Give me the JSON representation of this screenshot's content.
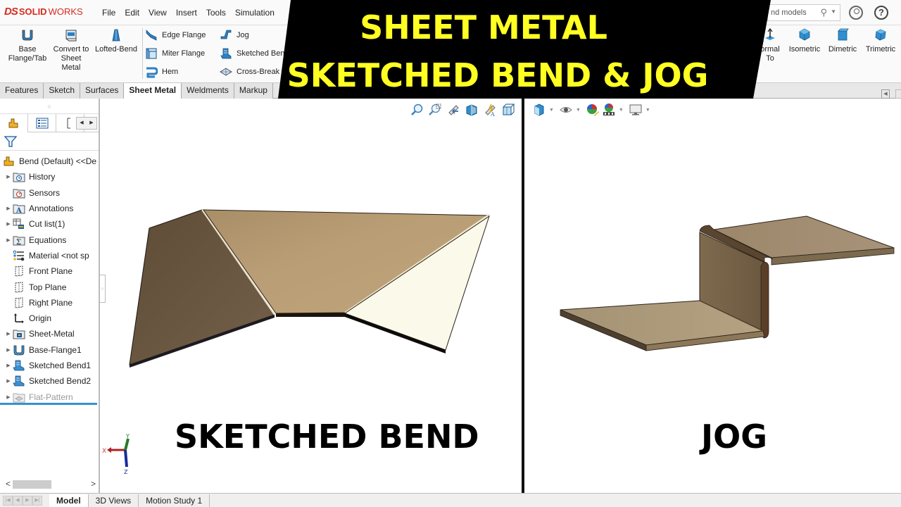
{
  "app": {
    "brand_prefix": "DS",
    "brand_bold": "SOLID",
    "brand_light": "WORKS"
  },
  "menu": [
    "File",
    "Edit",
    "View",
    "Insert",
    "Tools",
    "Simulation"
  ],
  "search": {
    "placeholder_visible": "nd models"
  },
  "ribbon": {
    "big_buttons": [
      {
        "label": "Base Flange/Tab",
        "icon": "base-flange-icon"
      },
      {
        "label": "Convert to Sheet Metal",
        "icon": "convert-sheet-metal-icon"
      },
      {
        "label": "Lofted-Bend",
        "icon": "lofted-bend-icon"
      }
    ],
    "small_buttons": [
      {
        "label": "Edge Flange",
        "icon": "edge-flange-icon"
      },
      {
        "label": "Miter Flange",
        "icon": "miter-flange-icon"
      },
      {
        "label": "Hem",
        "icon": "hem-icon"
      },
      {
        "label": "Jog",
        "icon": "jog-icon"
      },
      {
        "label": "Sketched Ben",
        "icon": "sketched-bend-icon"
      },
      {
        "label": "Cross-Break",
        "icon": "cross-break-icon"
      }
    ],
    "view_buttons": [
      {
        "label": "ormal To",
        "icon": "normal-to-icon"
      },
      {
        "label": "Isometric",
        "icon": "isometric-icon"
      },
      {
        "label": "Dimetric",
        "icon": "dimetric-icon"
      },
      {
        "label": "Trimetric",
        "icon": "trimetric-icon"
      }
    ]
  },
  "command_tabs": [
    {
      "label": "Features",
      "active": false
    },
    {
      "label": "Sketch",
      "active": false
    },
    {
      "label": "Surfaces",
      "active": false
    },
    {
      "label": "Sheet Metal",
      "active": true
    },
    {
      "label": "Weldments",
      "active": false
    },
    {
      "label": "Markup",
      "active": false
    }
  ],
  "feature_tree": {
    "root": "Bend (Default) <<De",
    "items": [
      {
        "label": "History",
        "icon": "history-folder-icon",
        "expandable": true
      },
      {
        "label": "Sensors",
        "icon": "sensors-folder-icon",
        "expandable": false
      },
      {
        "label": "Annotations",
        "icon": "annotations-folder-icon",
        "expandable": true
      },
      {
        "label": "Cut list(1)",
        "icon": "cut-list-icon",
        "expandable": true
      },
      {
        "label": "Equations",
        "icon": "equations-folder-icon",
        "expandable": true
      },
      {
        "label": "Material <not sp",
        "icon": "material-icon",
        "expandable": false
      },
      {
        "label": "Front Plane",
        "icon": "plane-icon",
        "expandable": false
      },
      {
        "label": "Top Plane",
        "icon": "plane-icon",
        "expandable": false
      },
      {
        "label": "Right Plane",
        "icon": "plane-icon",
        "expandable": false
      },
      {
        "label": "Origin",
        "icon": "origin-icon",
        "expandable": false
      },
      {
        "label": "Sheet-Metal",
        "icon": "sheet-metal-folder-icon",
        "expandable": true
      },
      {
        "label": "Base-Flange1",
        "icon": "base-flange-icon",
        "expandable": true
      },
      {
        "label": "Sketched Bend1",
        "icon": "sketched-bend-icon",
        "expandable": true
      },
      {
        "label": "Sketched Bend2",
        "icon": "sketched-bend-icon",
        "expandable": true
      },
      {
        "label": "Flat-Pattern",
        "icon": "flat-pattern-icon",
        "expandable": true,
        "suppressed": true
      }
    ]
  },
  "bottom_tabs": [
    {
      "label": "Model",
      "active": true
    },
    {
      "label": "3D Views",
      "active": false
    },
    {
      "label": "Motion Study 1",
      "active": false
    }
  ],
  "banner": {
    "line1": "SHEET METAL",
    "line2": "SKETCHED BEND & JOG"
  },
  "captions": {
    "left": "SKETCHED BEND",
    "right": "JOG"
  },
  "triad": {
    "x": "X",
    "y": "Y",
    "z": "Z"
  },
  "colors": {
    "brand_red": "#d52b1e",
    "banner_bg": "#000000",
    "banner_text": "#ffff22",
    "metal_dark": "#6e5a40",
    "metal_mid": "#b79a72",
    "metal_light": "#fdfbec",
    "rollback_bar": "#3a8fd0"
  }
}
